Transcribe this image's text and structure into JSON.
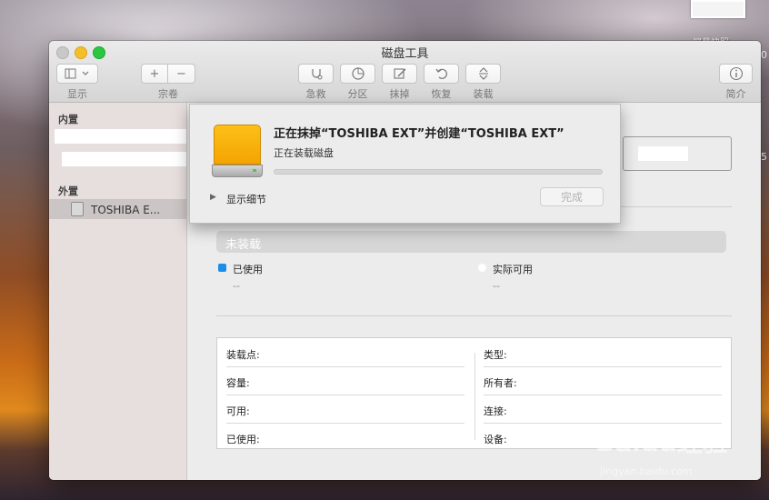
{
  "desktop": {
    "thumbnail_label": "屏幕快照",
    "edge_a": "0",
    "edge_b": "5"
  },
  "window": {
    "title": "磁盘工具",
    "toolbar": {
      "view_label": "显示",
      "volume_add": "+",
      "volume_remove": "−",
      "volume_label": "宗卷",
      "firstaid_label": "急救",
      "partition_label": "分区",
      "erase_label": "抹掉",
      "restore_label": "恢复",
      "mount_label": "装载",
      "info_label": "简介"
    }
  },
  "sidebar": {
    "internal_header": "内置",
    "external_header": "外置",
    "selected_item": "TOSHIBA E..."
  },
  "main": {
    "unmounted": "未装载",
    "legend_used": "已使用",
    "legend_used_value": "--",
    "legend_available": "实际可用",
    "legend_available_value": "--",
    "info": {
      "left": [
        "装载点:",
        "容量:",
        "可用:",
        "已使用:"
      ],
      "right": [
        "类型:",
        "所有者:",
        "连接:",
        "设备:"
      ]
    }
  },
  "sheet": {
    "title": "正在抹掉“TOSHIBA EXT”并创建“TOSHIBA EXT”",
    "status": "正在装载磁盘",
    "progress": 0.0,
    "details_label": "显示细节",
    "done_label": "完成"
  },
  "watermark": {
    "text": "Baidu经验",
    "sub": "jingyan.baidu.com"
  },
  "colors": {
    "used_legend": "#1a8fe8",
    "available_legend": "#ffffff",
    "disk_orange": "#fdbf19",
    "progress_accent": "#3a87f1"
  }
}
